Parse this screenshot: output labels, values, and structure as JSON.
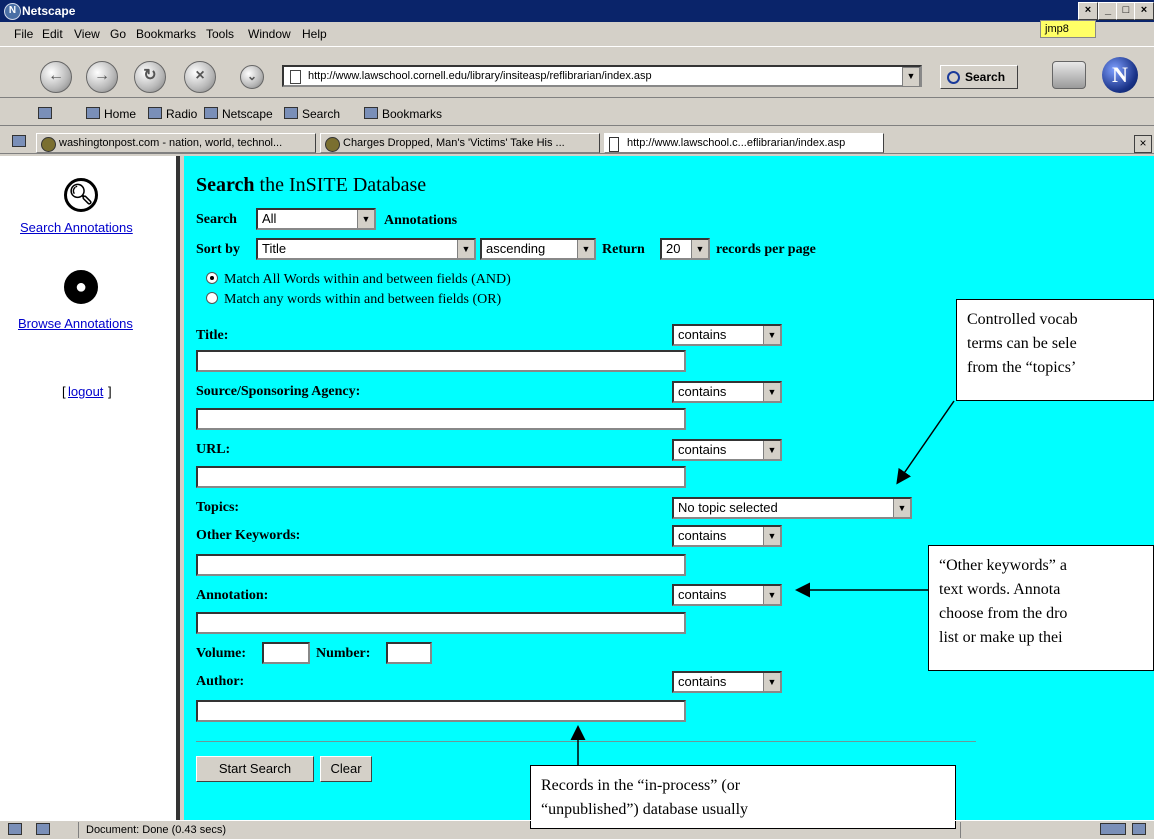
{
  "window": {
    "title": "Netscape",
    "tooltip": "jmp8"
  },
  "menu": {
    "file": "File",
    "edit": "Edit",
    "view": "View",
    "go": "Go",
    "bookmarks": "Bookmarks",
    "tools": "Tools",
    "window": "Window",
    "help": "Help"
  },
  "nav": {
    "url": "http://www.lawschool.cornell.edu/library/insiteasp/reflibrarian/index.asp",
    "search_label": "Search"
  },
  "personal_toolbar": {
    "home": "Home",
    "radio": "Radio",
    "netscape": "Netscape",
    "search": "Search",
    "bookmarks": "Bookmarks"
  },
  "tabs": [
    {
      "label": "washingtonpost.com - nation, world, technol..."
    },
    {
      "label": "Charges Dropped, Man's 'Victims' Take His ..."
    },
    {
      "label": "http://www.lawschool.c...eflibrarian/index.asp"
    }
  ],
  "sidebar": {
    "search_annotations": "Search Annotations",
    "browse_annotations": "Browse Annotations",
    "logout_bracket_open": "[",
    "logout": "logout",
    "logout_bracket_close": "]"
  },
  "form": {
    "title_bold": "Search",
    "title_rest": " the InSITE Database",
    "search_label": "Search",
    "search_value": "All",
    "annotations_label": "Annotations",
    "sortby_label": "Sort by",
    "sortby_value": "Title",
    "order_value": "ascending",
    "return_label": "Return",
    "return_value": "20",
    "records_per_page": "records per page",
    "match_all": "Match All Words within and between fields (AND)",
    "match_any": "Match any words within and between fields (OR)",
    "title_field": "Title:",
    "source_field": "Source/Sponsoring Agency:",
    "url_field": "URL:",
    "topics_field": "Topics:",
    "topics_value": "No topic selected",
    "other_keywords_field": "Other Keywords:",
    "annotation_field": "Annotation:",
    "volume_field": "Volume:",
    "number_field": "Number:",
    "author_field": "Author:",
    "contains": "contains",
    "start_search": "Start Search",
    "clear": "Clear"
  },
  "callouts": {
    "topics_line1": "Controlled vocab",
    "topics_line2": "terms can be sele",
    "topics_line3": "from the “topics’",
    "keywords_line1": "“Other keywords” a",
    "keywords_line2": "text words.  Annota",
    "keywords_line3": "choose from the dro",
    "keywords_line4": "list or make up thei",
    "records_line1": "Records in the “in-process” (or",
    "records_line2": "“unpublished”) database usually"
  },
  "status": {
    "text": "Document: Done (0.43 secs)"
  },
  "colors": {
    "content_bg": "#00ffff",
    "titlebar_bg": "#0a246a",
    "link": "#0000cc"
  }
}
